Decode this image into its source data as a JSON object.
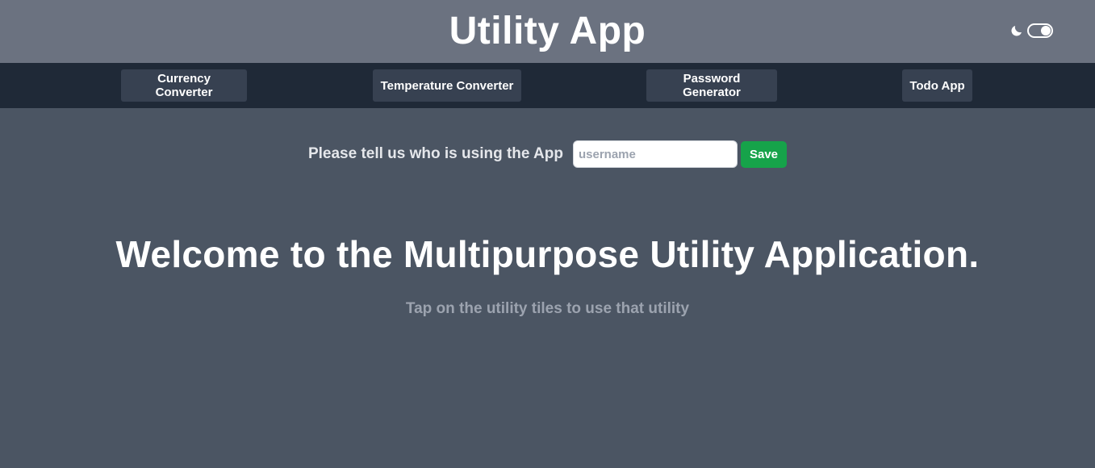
{
  "header": {
    "title": "Utility App",
    "theme_icon": "moon-icon",
    "dark_mode_enabled": true
  },
  "nav": {
    "items": [
      {
        "label": "Currency Converter"
      },
      {
        "label": "Temperature Converter"
      },
      {
        "label": "Password Generator"
      },
      {
        "label": "Todo App"
      }
    ]
  },
  "user_form": {
    "prompt": "Please tell us who is using the App",
    "input_value": "",
    "input_placeholder": "username",
    "save_label": "Save"
  },
  "main": {
    "heading": "Welcome to the Multipurpose Utility Application.",
    "subheading": "Tap on the utility tiles to use that utility"
  },
  "colors": {
    "header_bg": "#6b7280",
    "nav_bg": "#1f2937",
    "nav_button_bg": "#374151",
    "page_bg": "#4b5563",
    "save_button": "#16a34a",
    "subtitle_text": "#9ca3af"
  }
}
